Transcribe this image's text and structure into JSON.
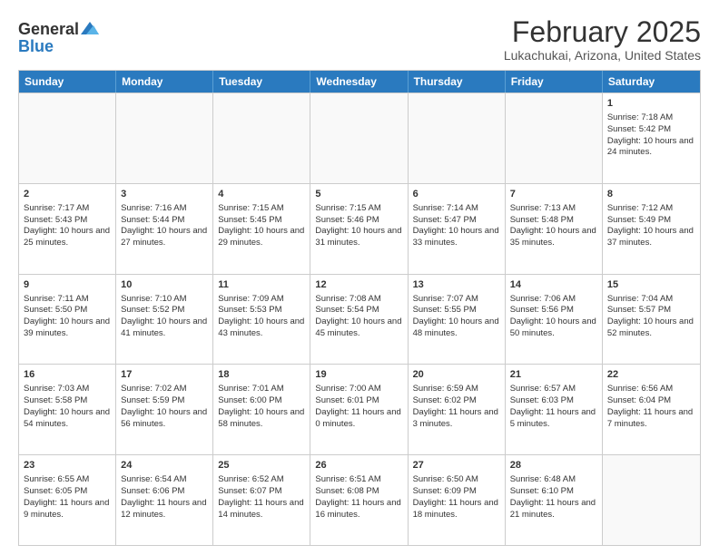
{
  "logo": {
    "general": "General",
    "blue": "Blue"
  },
  "title": "February 2025",
  "location": "Lukachukai, Arizona, United States",
  "days_of_week": [
    "Sunday",
    "Monday",
    "Tuesday",
    "Wednesday",
    "Thursday",
    "Friday",
    "Saturday"
  ],
  "weeks": [
    [
      {
        "day": "",
        "empty": true,
        "info": ""
      },
      {
        "day": "",
        "empty": true,
        "info": ""
      },
      {
        "day": "",
        "empty": true,
        "info": ""
      },
      {
        "day": "",
        "empty": true,
        "info": ""
      },
      {
        "day": "",
        "empty": true,
        "info": ""
      },
      {
        "day": "",
        "empty": true,
        "info": ""
      },
      {
        "day": "1",
        "empty": false,
        "info": "Sunrise: 7:18 AM\nSunset: 5:42 PM\nDaylight: 10 hours and 24 minutes."
      }
    ],
    [
      {
        "day": "2",
        "empty": false,
        "info": "Sunrise: 7:17 AM\nSunset: 5:43 PM\nDaylight: 10 hours and 25 minutes."
      },
      {
        "day": "3",
        "empty": false,
        "info": "Sunrise: 7:16 AM\nSunset: 5:44 PM\nDaylight: 10 hours and 27 minutes."
      },
      {
        "day": "4",
        "empty": false,
        "info": "Sunrise: 7:15 AM\nSunset: 5:45 PM\nDaylight: 10 hours and 29 minutes."
      },
      {
        "day": "5",
        "empty": false,
        "info": "Sunrise: 7:15 AM\nSunset: 5:46 PM\nDaylight: 10 hours and 31 minutes."
      },
      {
        "day": "6",
        "empty": false,
        "info": "Sunrise: 7:14 AM\nSunset: 5:47 PM\nDaylight: 10 hours and 33 minutes."
      },
      {
        "day": "7",
        "empty": false,
        "info": "Sunrise: 7:13 AM\nSunset: 5:48 PM\nDaylight: 10 hours and 35 minutes."
      },
      {
        "day": "8",
        "empty": false,
        "info": "Sunrise: 7:12 AM\nSunset: 5:49 PM\nDaylight: 10 hours and 37 minutes."
      }
    ],
    [
      {
        "day": "9",
        "empty": false,
        "info": "Sunrise: 7:11 AM\nSunset: 5:50 PM\nDaylight: 10 hours and 39 minutes."
      },
      {
        "day": "10",
        "empty": false,
        "info": "Sunrise: 7:10 AM\nSunset: 5:52 PM\nDaylight: 10 hours and 41 minutes."
      },
      {
        "day": "11",
        "empty": false,
        "info": "Sunrise: 7:09 AM\nSunset: 5:53 PM\nDaylight: 10 hours and 43 minutes."
      },
      {
        "day": "12",
        "empty": false,
        "info": "Sunrise: 7:08 AM\nSunset: 5:54 PM\nDaylight: 10 hours and 45 minutes."
      },
      {
        "day": "13",
        "empty": false,
        "info": "Sunrise: 7:07 AM\nSunset: 5:55 PM\nDaylight: 10 hours and 48 minutes."
      },
      {
        "day": "14",
        "empty": false,
        "info": "Sunrise: 7:06 AM\nSunset: 5:56 PM\nDaylight: 10 hours and 50 minutes."
      },
      {
        "day": "15",
        "empty": false,
        "info": "Sunrise: 7:04 AM\nSunset: 5:57 PM\nDaylight: 10 hours and 52 minutes."
      }
    ],
    [
      {
        "day": "16",
        "empty": false,
        "info": "Sunrise: 7:03 AM\nSunset: 5:58 PM\nDaylight: 10 hours and 54 minutes."
      },
      {
        "day": "17",
        "empty": false,
        "info": "Sunrise: 7:02 AM\nSunset: 5:59 PM\nDaylight: 10 hours and 56 minutes."
      },
      {
        "day": "18",
        "empty": false,
        "info": "Sunrise: 7:01 AM\nSunset: 6:00 PM\nDaylight: 10 hours and 58 minutes."
      },
      {
        "day": "19",
        "empty": false,
        "info": "Sunrise: 7:00 AM\nSunset: 6:01 PM\nDaylight: 11 hours and 0 minutes."
      },
      {
        "day": "20",
        "empty": false,
        "info": "Sunrise: 6:59 AM\nSunset: 6:02 PM\nDaylight: 11 hours and 3 minutes."
      },
      {
        "day": "21",
        "empty": false,
        "info": "Sunrise: 6:57 AM\nSunset: 6:03 PM\nDaylight: 11 hours and 5 minutes."
      },
      {
        "day": "22",
        "empty": false,
        "info": "Sunrise: 6:56 AM\nSunset: 6:04 PM\nDaylight: 11 hours and 7 minutes."
      }
    ],
    [
      {
        "day": "23",
        "empty": false,
        "info": "Sunrise: 6:55 AM\nSunset: 6:05 PM\nDaylight: 11 hours and 9 minutes."
      },
      {
        "day": "24",
        "empty": false,
        "info": "Sunrise: 6:54 AM\nSunset: 6:06 PM\nDaylight: 11 hours and 12 minutes."
      },
      {
        "day": "25",
        "empty": false,
        "info": "Sunrise: 6:52 AM\nSunset: 6:07 PM\nDaylight: 11 hours and 14 minutes."
      },
      {
        "day": "26",
        "empty": false,
        "info": "Sunrise: 6:51 AM\nSunset: 6:08 PM\nDaylight: 11 hours and 16 minutes."
      },
      {
        "day": "27",
        "empty": false,
        "info": "Sunrise: 6:50 AM\nSunset: 6:09 PM\nDaylight: 11 hours and 18 minutes."
      },
      {
        "day": "28",
        "empty": false,
        "info": "Sunrise: 6:48 AM\nSunset: 6:10 PM\nDaylight: 11 hours and 21 minutes."
      },
      {
        "day": "",
        "empty": true,
        "info": ""
      }
    ]
  ]
}
